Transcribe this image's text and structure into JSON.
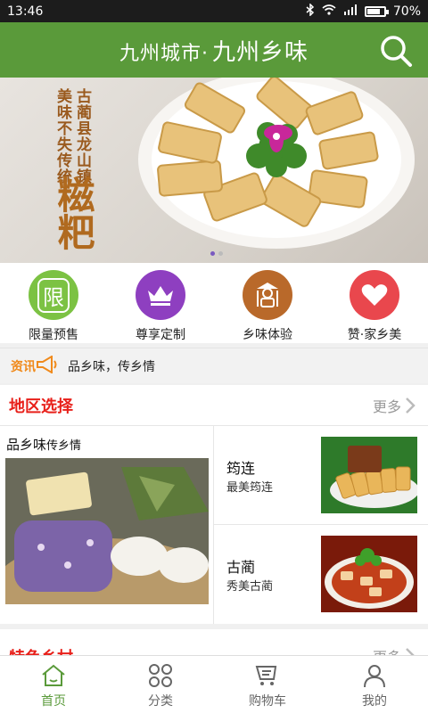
{
  "status_bar": {
    "time": "13:46",
    "battery": "70%"
  },
  "header": {
    "title_prefix": "九州城市·",
    "title_script": "九州乡味",
    "search_icon": "search-icon"
  },
  "banner": {
    "col1": "美味不失传统",
    "col2": "古蔺县龙山镇",
    "big_text": "糍粑",
    "slides": 2,
    "active_slide": 1
  },
  "categories": [
    {
      "label": "限量预售",
      "icon": "limit-icon",
      "icon_text": "限",
      "color": "#7cc243"
    },
    {
      "label": "尊享定制",
      "icon": "crown-icon",
      "color": "#8e3fc0"
    },
    {
      "label": "乡味体验",
      "icon": "farmer-icon",
      "color": "#b9692a"
    },
    {
      "label": "赞·家乡美",
      "icon": "heart-icon",
      "color": "#e9474d"
    }
  ],
  "news": {
    "tag": "资讯",
    "icon": "megaphone-icon",
    "text": "品乡味，传乡情"
  },
  "region": {
    "title": "地区选择",
    "more": "更多",
    "feature_title_main": "品乡味",
    "feature_title_small": "传乡情",
    "items": [
      {
        "name": "筠连",
        "sub": "最美筠连"
      },
      {
        "name": "古蔺",
        "sub": "秀美古蔺"
      }
    ]
  },
  "section2": {
    "title": "特色乡村",
    "more": "更多"
  },
  "tabbar": [
    {
      "label": "首页",
      "icon": "home-icon",
      "active": true
    },
    {
      "label": "分类",
      "icon": "grid-icon",
      "active": false
    },
    {
      "label": "购物车",
      "icon": "cart-icon",
      "active": false
    },
    {
      "label": "我的",
      "icon": "user-icon",
      "active": false
    }
  ],
  "colors": {
    "brand_green": "#5a9a3a",
    "section_red": "#e8201a",
    "news_orange": "#f08a1c"
  }
}
